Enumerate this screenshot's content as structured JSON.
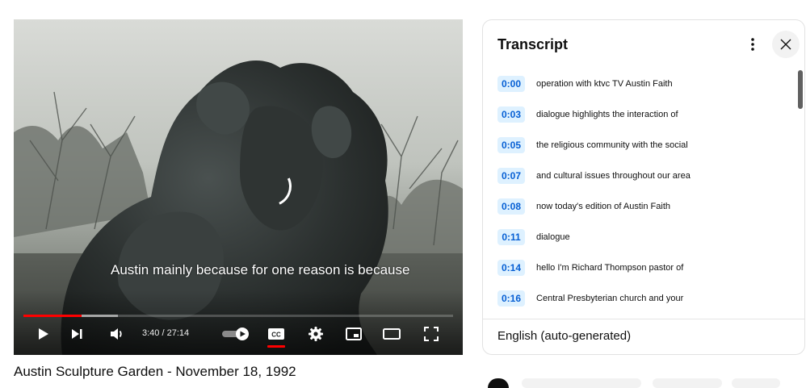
{
  "player": {
    "caption_text": "Austin mainly because for one reason is because",
    "time_current": "3:40",
    "time_separator": " / ",
    "time_total": "27:14",
    "progress_played_fraction": 0.135,
    "progress_buffered_fraction": 0.22,
    "autoplay_on": true,
    "captions_on": true,
    "icons": {
      "play": "play-icon",
      "next": "next-icon",
      "volume": "volume-icon",
      "autoplay": "autoplay-toggle-icon",
      "captions": "cc-icon",
      "settings": "gear-icon",
      "miniplayer": "miniplayer-icon",
      "theater": "theater-mode-icon",
      "fullscreen": "fullscreen-icon"
    },
    "cc_label": "CC"
  },
  "video": {
    "title": "Austin Sculpture Garden - November 18, 1992"
  },
  "transcript": {
    "title": "Transcript",
    "more_icon": "more-vert-icon",
    "close_icon": "close-icon",
    "segments": [
      {
        "time": "0:00",
        "text": "operation with ktvc TV Austin Faith"
      },
      {
        "time": "0:03",
        "text": "dialogue highlights the interaction of"
      },
      {
        "time": "0:05",
        "text": "the religious community with the social"
      },
      {
        "time": "0:07",
        "text": "and cultural issues throughout our area"
      },
      {
        "time": "0:08",
        "text": "now today's edition of Austin Faith"
      },
      {
        "time": "0:11",
        "text": "dialogue"
      },
      {
        "time": "0:14",
        "text": "hello I'm Richard Thompson pastor of"
      },
      {
        "time": "0:16",
        "text": "Central Presbyterian church and your"
      }
    ],
    "language": "English (auto-generated)"
  },
  "colors": {
    "accent_red": "#ff0000",
    "timestamp_bg": "#def1ff",
    "timestamp_text": "#065fd4"
  }
}
